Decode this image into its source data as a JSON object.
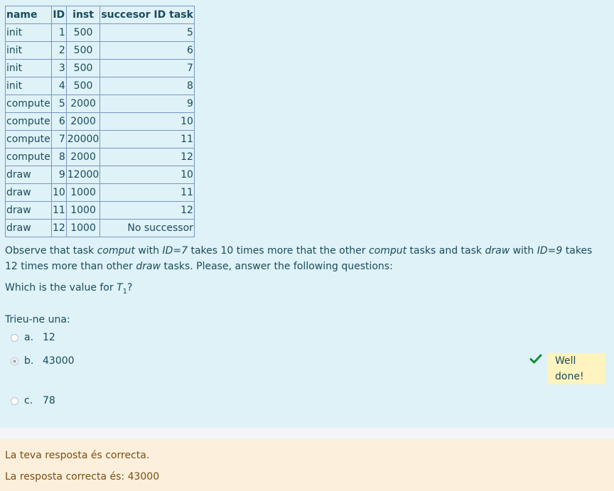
{
  "table": {
    "headers": [
      "name",
      "ID",
      "inst",
      "succesor ID task"
    ],
    "rows": [
      [
        "init",
        "1",
        "500",
        "5"
      ],
      [
        "init",
        "2",
        "500",
        "6"
      ],
      [
        "init",
        "3",
        "500",
        "7"
      ],
      [
        "init",
        "4",
        "500",
        "8"
      ],
      [
        "compute",
        "5",
        "2000",
        "9"
      ],
      [
        "compute",
        "6",
        "2000",
        "10"
      ],
      [
        "compute",
        "7",
        "20000",
        "11"
      ],
      [
        "compute",
        "8",
        "2000",
        "12"
      ],
      [
        "draw",
        "9",
        "12000",
        "10"
      ],
      [
        "draw",
        "10",
        "1000",
        "11"
      ],
      [
        "draw",
        "11",
        "1000",
        "12"
      ],
      [
        "draw",
        "12",
        "1000",
        "No successor"
      ]
    ]
  },
  "question": {
    "p1_a": "Observe that task ",
    "p1_b": "comput",
    "p1_c": " with ",
    "p1_d": "ID=7",
    "p1_e": " takes 10 times more that the other ",
    "p1_f": "comput",
    "p1_g": " tasks and task ",
    "p1_h": "draw",
    "p1_i": " with ",
    "p1_j": "ID=9",
    "p1_k": " takes 12 times more than other ",
    "p1_l": "draw",
    "p1_m": " tasks. Please, answer the following questions:",
    "p2_a": "Which is the value for ",
    "p2_var": "T",
    "p2_sub": "1",
    "p2_end": "?"
  },
  "answer": {
    "prompt": "Trieu-ne una:",
    "options": [
      {
        "letter": "a.",
        "text": "12",
        "selected": false
      },
      {
        "letter": "b.",
        "text": "43000",
        "selected": true
      },
      {
        "letter": "c.",
        "text": "78",
        "selected": false
      }
    ],
    "feedback": "Well done!",
    "check_icon": "check-icon",
    "check_color": "#1b8a3c"
  },
  "outcome": {
    "correct_msg": "La teva resposta és correcta.",
    "right_answer": "La resposta correcta és: 43000"
  }
}
